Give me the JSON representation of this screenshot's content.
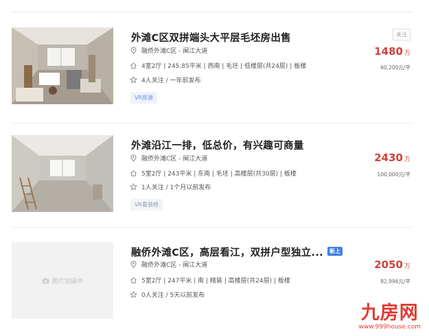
{
  "listings": [
    {
      "title": "外滩C区双拼端头大平层毛坯房出售",
      "new_badge": "",
      "follow_label": "关注",
      "location": "融侨外滩C区 - 闽江大道",
      "specs": "4室2厅 | 245.85平米 | 西南 | 毛坯 | 低楼层(共24层) | 板楼",
      "followers": "4人关注 / 一年前发布",
      "tag": "VR房源",
      "price": "1480",
      "price_unit": "万",
      "unit_price": "60,200元/平",
      "thumb": "photo-renovation-room"
    },
    {
      "title": "外滩沿江一排，低总价，有兴趣可商量",
      "new_badge": "",
      "follow_label": "",
      "location": "融侨外滩C区 - 闽江大道",
      "specs": "5室2厅 | 243平米 | 东南 | 毛坯 | 高楼层(共30层) | 板楼",
      "followers": "1人关注 / 1个月以前发布",
      "tag": "VR看装修",
      "price": "2430",
      "price_unit": "万",
      "unit_price": "100,000元/平",
      "thumb": "photo-empty-room"
    },
    {
      "title": "融侨外滩C区，高层看江，双拼户型独立...",
      "new_badge": "新上",
      "follow_label": "",
      "location": "融侨外滩C区 - 闽江大道",
      "specs": "5室2厅 | 247平米 | 南 | 精装 | 高楼层(共24层) | 板楼",
      "followers": "0人关注 / 5天以前发布",
      "tag": "",
      "price": "2050",
      "price_unit": "万",
      "unit_price": "82,996元/平",
      "thumb_placeholder": "图片拍摄中"
    }
  ],
  "watermark": {
    "logo": "九房网",
    "url": "www.999house.com"
  },
  "colors": {
    "price": "#d0433b",
    "badge": "#3f7ee8",
    "tag": "#6d8fd8",
    "watermark": "#e03c32"
  },
  "icons": [
    "location-pin-icon",
    "house-icon",
    "star-icon",
    "camera-icon"
  ]
}
